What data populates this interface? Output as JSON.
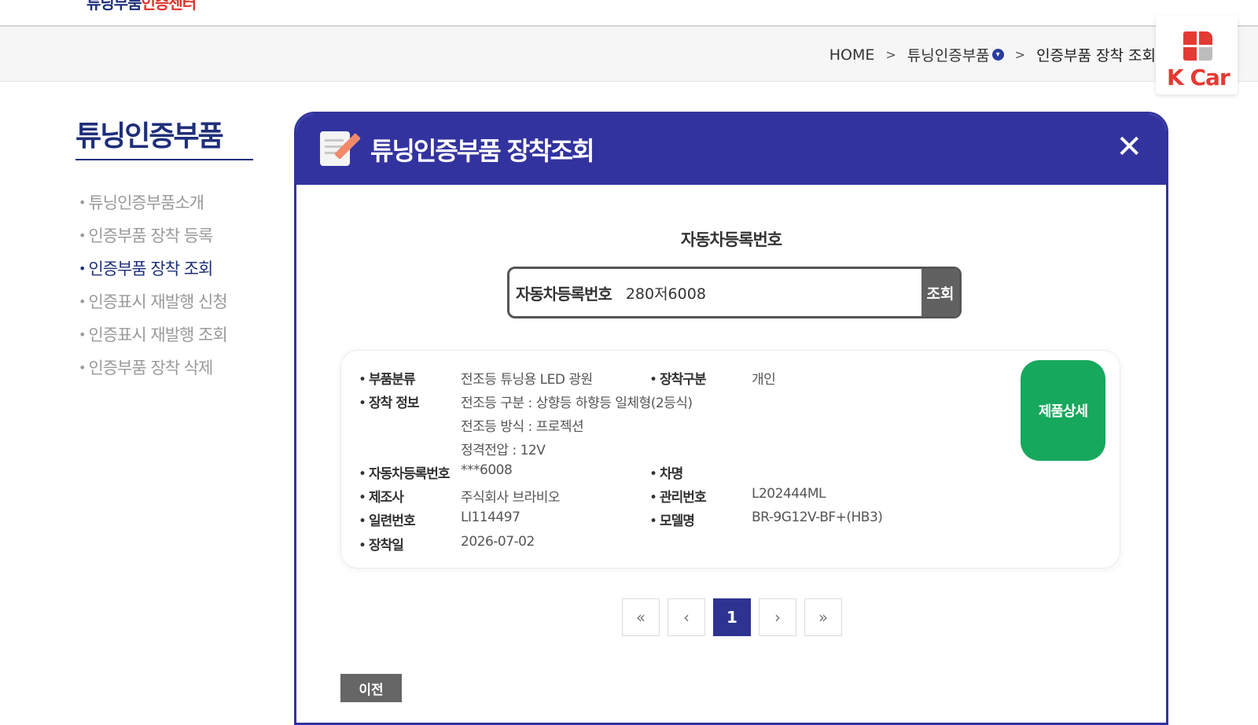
{
  "header": {
    "logo_part1": "튜닝부품",
    "logo_part2": "인증센터"
  },
  "breadcrumb": {
    "home": "HOME",
    "sep1": ">",
    "section": "튜닝인증부품",
    "sep2": ">",
    "current": "인증부품 장착 조회"
  },
  "kcar": {
    "brand": "K Car"
  },
  "sidebar": {
    "title": "튜닝인증부품",
    "items": [
      {
        "label": "튜닝인증부품소개"
      },
      {
        "label": "인증부품 장착 등록"
      },
      {
        "label": "인증부품 장착 조회"
      },
      {
        "label": "인증표시 재발행 신청"
      },
      {
        "label": "인증표시 재발행 조회"
      },
      {
        "label": "인증부품 장착 삭제"
      }
    ],
    "active_index": 2
  },
  "modal": {
    "title": "튜닝인증부품 장착조회",
    "close": "✕"
  },
  "search": {
    "heading": "자동차등록번호",
    "label": "자동차등록번호",
    "value": "280저6008",
    "button": "조회"
  },
  "result": {
    "part_category_label": "부품분류",
    "part_category": "전조등 튜닝용 LED 광원",
    "install_type_label": "장착구분",
    "install_type": "개인",
    "install_info_label": "장착 정보",
    "install_info": [
      "전조등 구분 : 상향등 하향등 일체형(2등식)",
      "전조등 방식 : 프로젝션",
      "정격전압 : 12V"
    ],
    "reg_no_label": "자동차등록번호",
    "reg_no": "***6008",
    "car_name_label": "차명",
    "car_name": "",
    "maker_label": "제조사",
    "maker": "주식회사 브라비오",
    "mgmt_no_label": "관리번호",
    "mgmt_no": "L202444ML",
    "serial_label": "일련번호",
    "serial": "LI114497",
    "model_label": "모델명",
    "model": "BR-9G12V-BF+(HB3)",
    "install_date_label": "장착일",
    "install_date": "2026-07-02",
    "detail_button": "제품상세"
  },
  "pagination": {
    "first": "«",
    "prev": "‹",
    "current": "1",
    "next": "›",
    "last": "»"
  },
  "prev_button": "이전",
  "colors": {
    "primary": "#3333a0",
    "detail_green": "#16a85c",
    "kcar_red": "#e53a33"
  }
}
